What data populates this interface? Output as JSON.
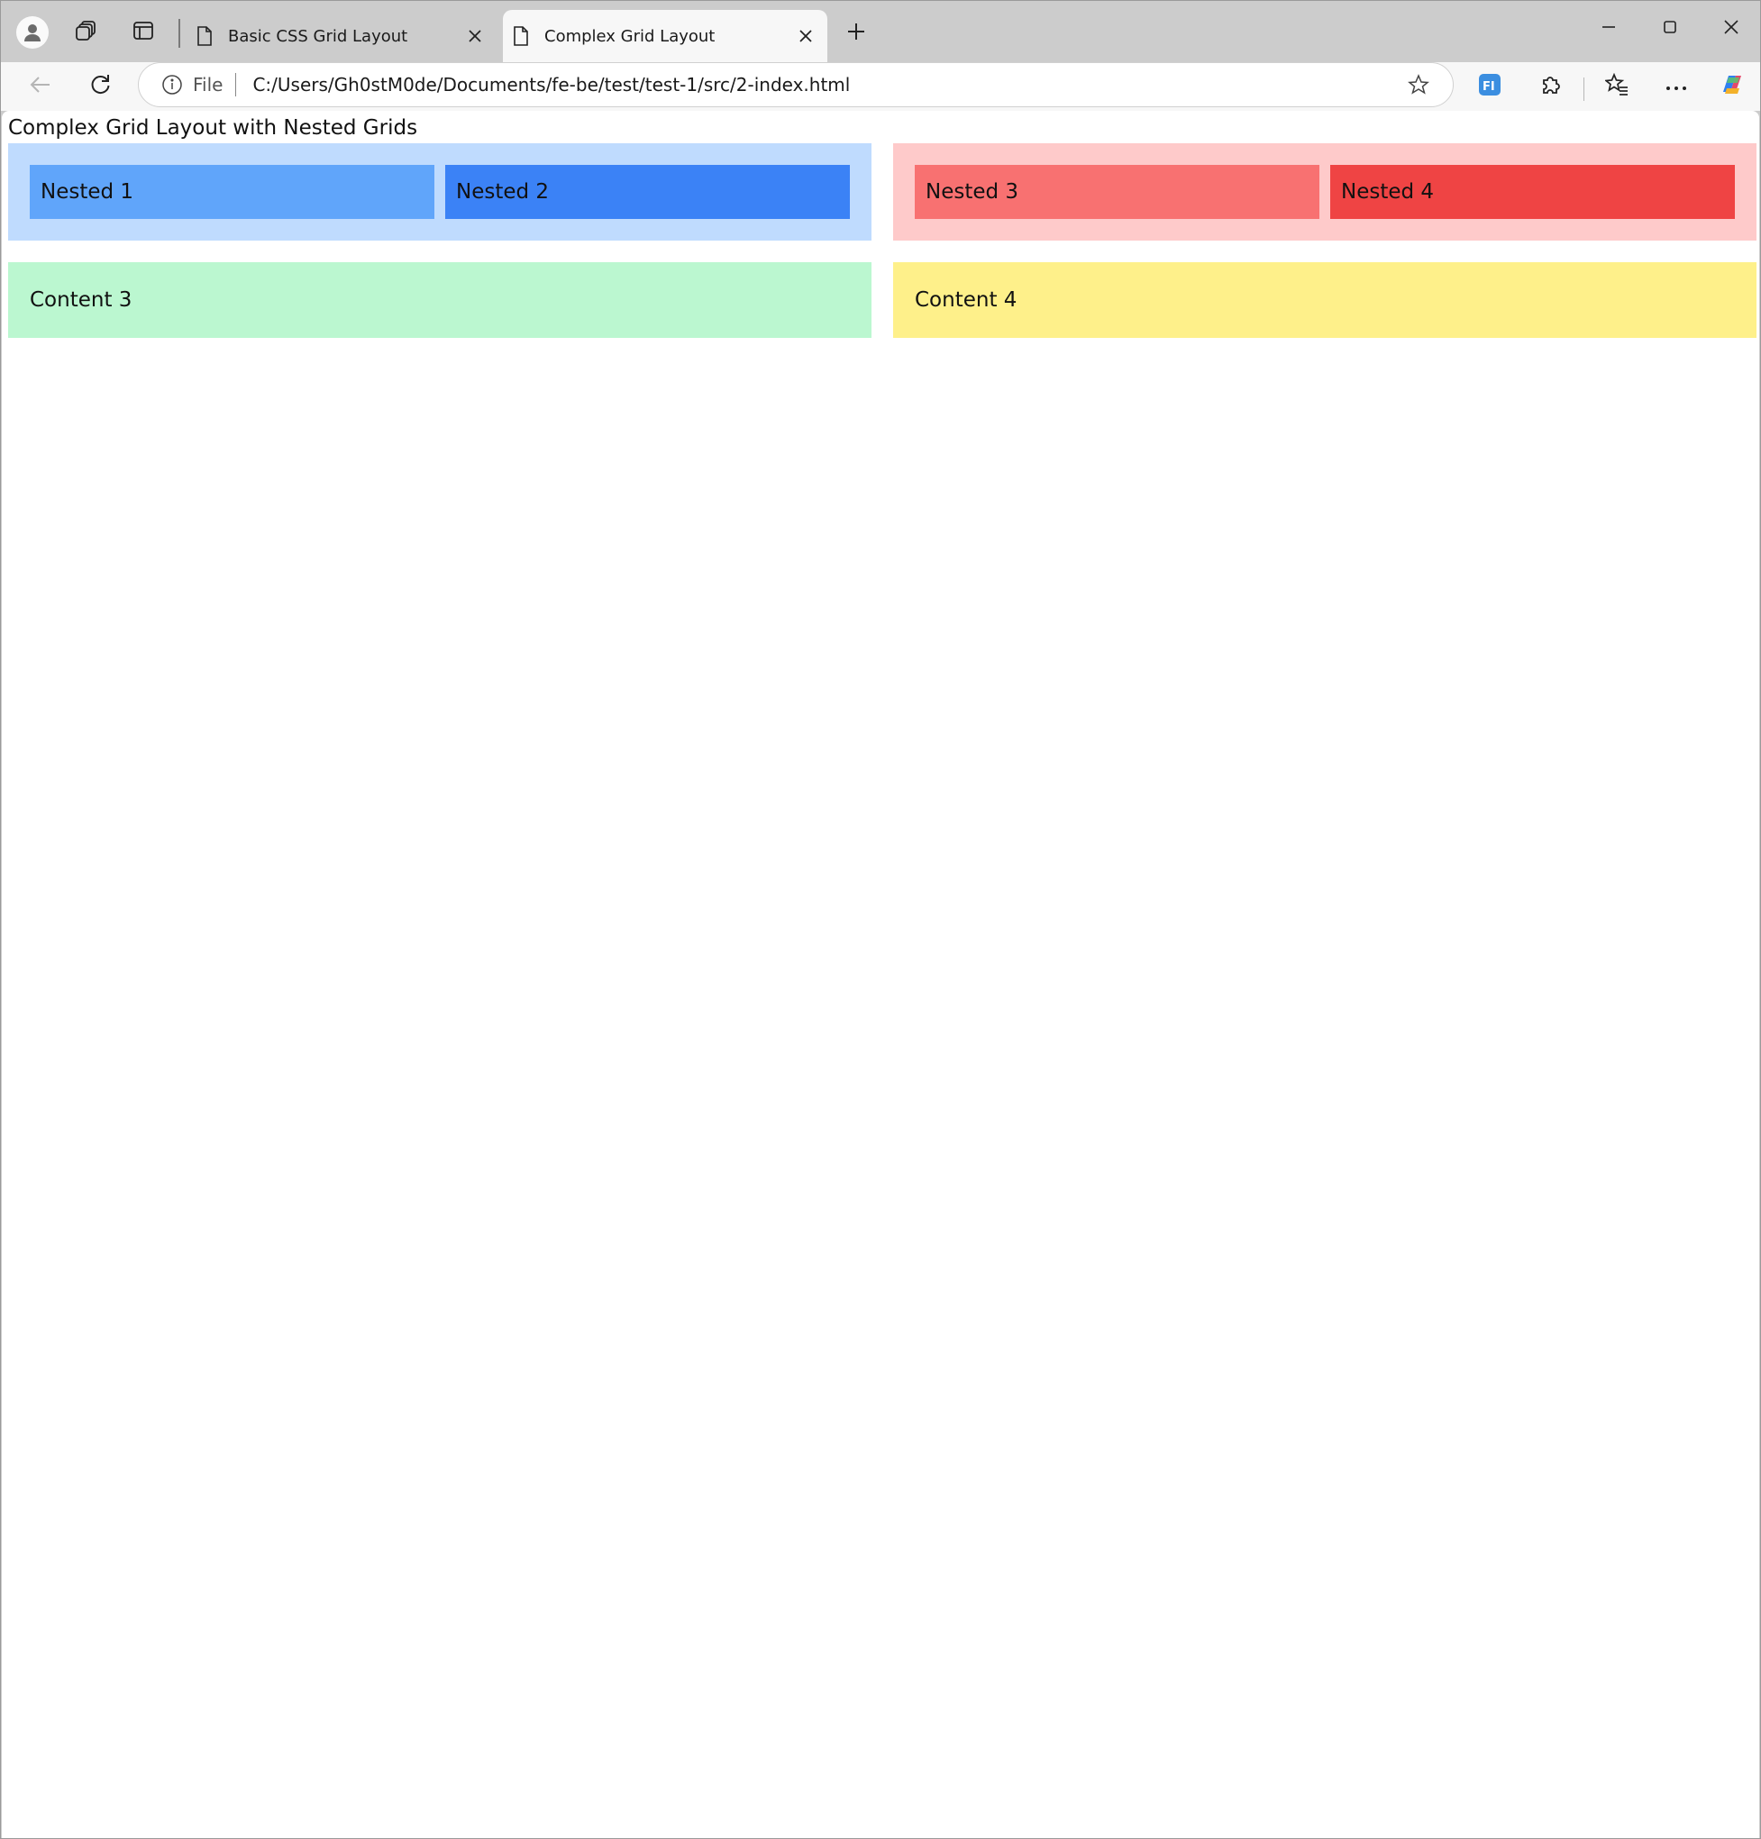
{
  "browser": {
    "tabs": [
      {
        "title": "Basic CSS Grid Layout",
        "active": false
      },
      {
        "title": "Complex Grid Layout",
        "active": true
      }
    ],
    "address": {
      "scheme_label": "File",
      "url": "C:/Users/Gh0stM0de/Documents/fe-be/test/test-1/src/2-index.html"
    },
    "icons": {
      "profile": "profile-icon",
      "workspaces": "workspaces-icon",
      "vertical_tabs": "vertical-tabs-icon",
      "new_tab": "plus-icon",
      "back": "back-arrow-icon",
      "refresh": "refresh-icon",
      "info": "info-icon",
      "favorite": "star-icon",
      "extension_fi": "fi-extension-icon",
      "extensions": "puzzle-icon",
      "favorites": "favorites-icon",
      "more": "more-icon",
      "copilot": "copilot-icon"
    }
  },
  "page": {
    "heading": "Complex Grid Layout with Nested Grids",
    "grid": {
      "cell1": {
        "background": "#bfdbfe",
        "items": [
          {
            "label": "Nested 1",
            "color": "#60a5fa"
          },
          {
            "label": "Nested 2",
            "color": "#3b82f6"
          }
        ]
      },
      "cell2": {
        "background": "#fecaca",
        "items": [
          {
            "label": "Nested 3",
            "color": "#f87171"
          },
          {
            "label": "Nested 4",
            "color": "#ef4444"
          }
        ]
      },
      "cell3": {
        "label": "Content 3",
        "background": "#bbf7d0"
      },
      "cell4": {
        "label": "Content 4",
        "background": "#fef08a"
      }
    }
  }
}
